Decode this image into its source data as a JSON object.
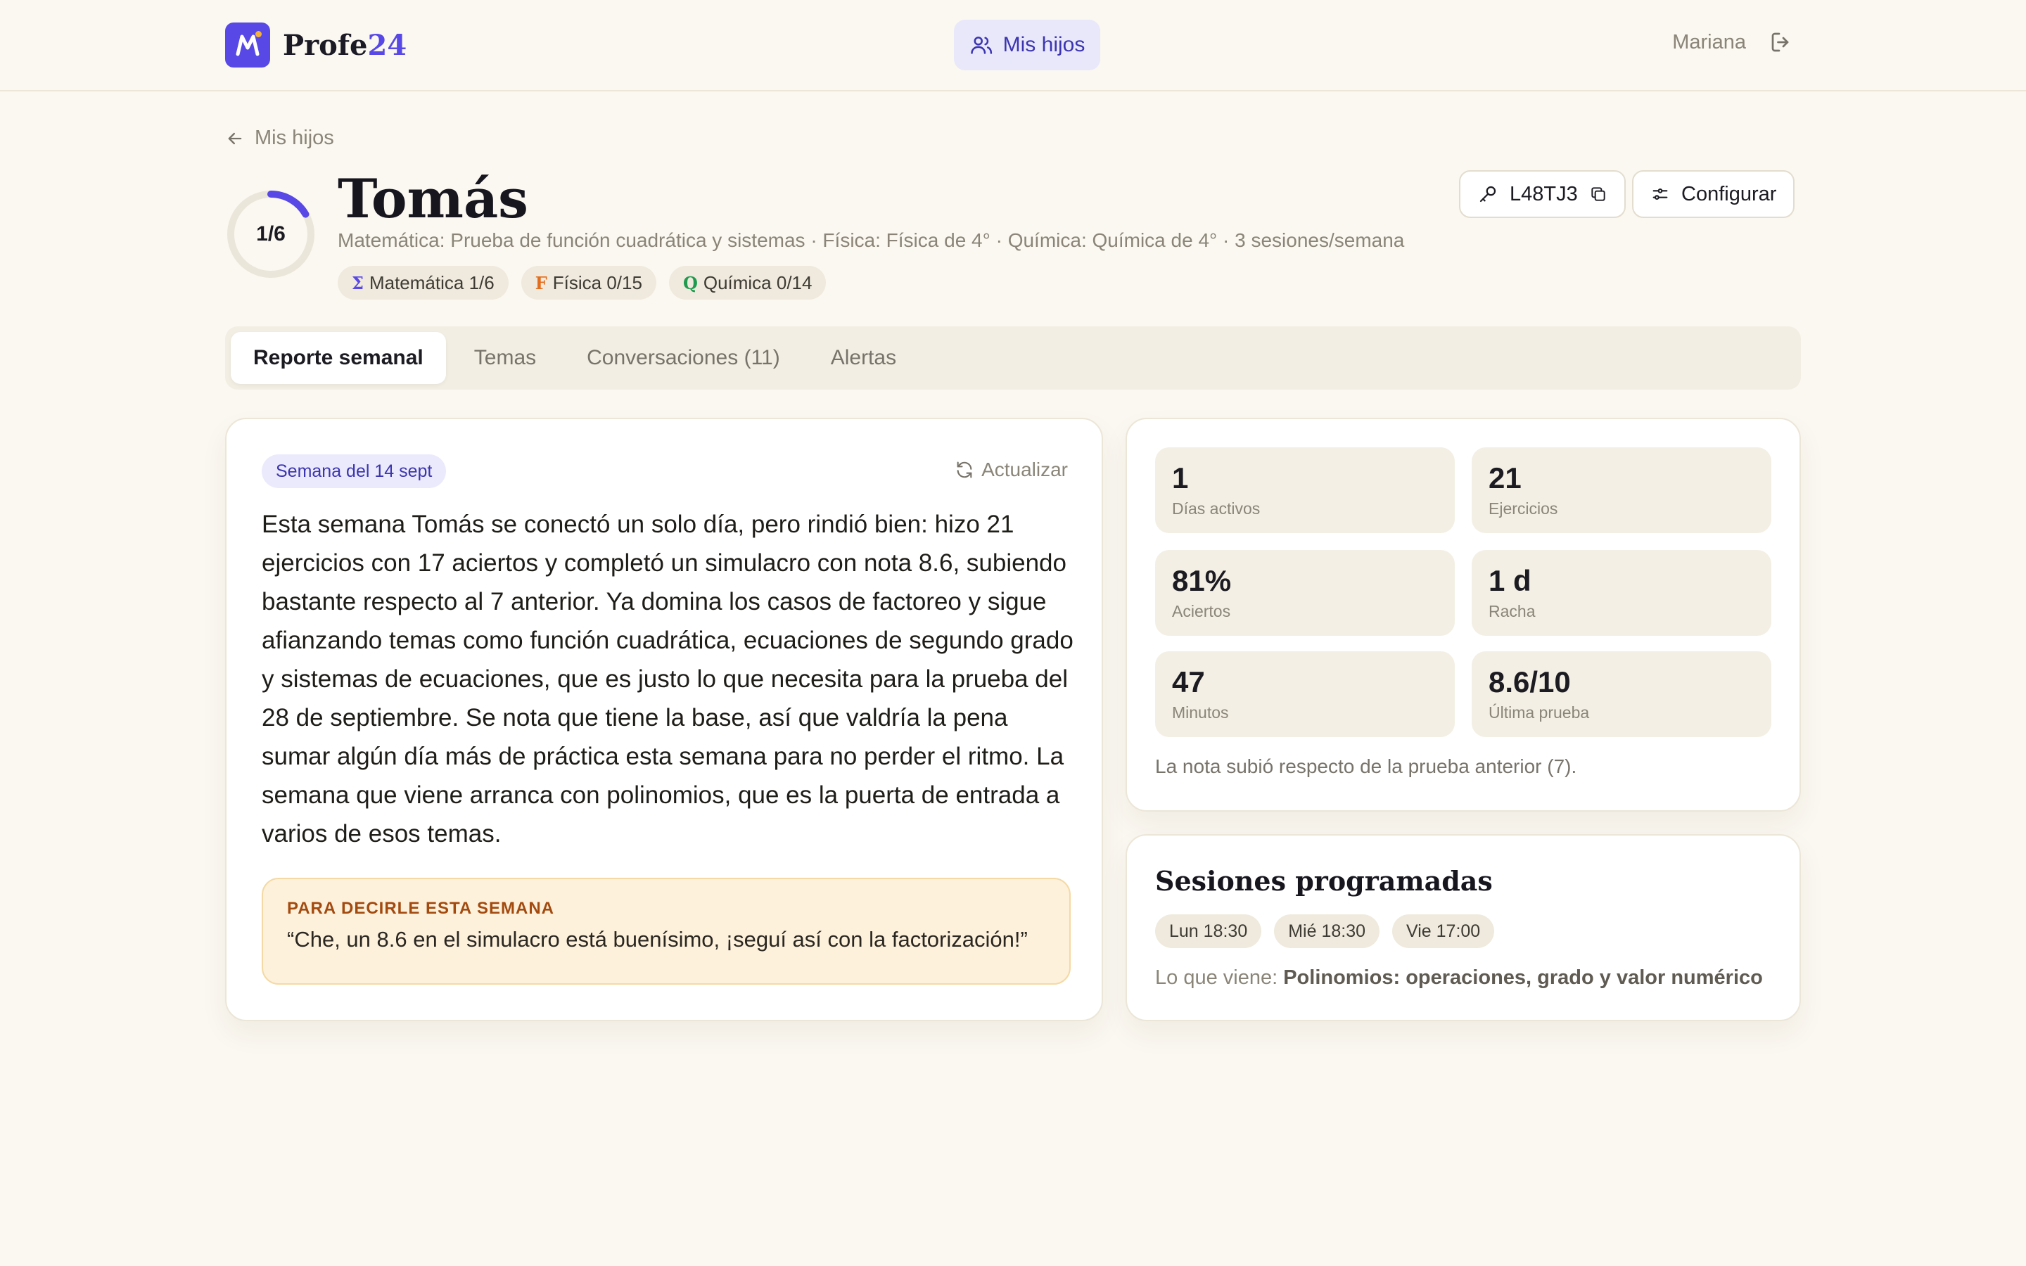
{
  "header": {
    "brand_prefix": "Profe",
    "brand_suffix": "24",
    "nav_label": "Mis hijos",
    "user_name": "Mariana"
  },
  "back_link": "Mis hijos",
  "profile": {
    "progress_label": "1/6",
    "progress_fraction": 0.1667,
    "name": "Tomás",
    "subtitle": "Matemática: Prueba de función cuadrática y sistemas · Física: Física de 4° · Química: Química de 4° · 3 sesiones/semana",
    "subjects": [
      {
        "symbol": "Σ",
        "label": "Matemática 1/6",
        "color": "#5848e6"
      },
      {
        "symbol": "F",
        "label": "Física 0/15",
        "color": "#e26d1c"
      },
      {
        "symbol": "Q",
        "label": "Química 0/14",
        "color": "#1f9a4e"
      }
    ],
    "code_label": "L48TJ3",
    "configure_label": "Configurar"
  },
  "tabs": [
    {
      "label": "Reporte semanal",
      "active": true
    },
    {
      "label": "Temas",
      "active": false
    },
    {
      "label": "Conversaciones (11)",
      "active": false
    },
    {
      "label": "Alertas",
      "active": false
    }
  ],
  "report": {
    "week_badge": "Semana del 14 sept",
    "refresh_label": "Actualizar",
    "body": "Esta semana Tomás se conectó un solo día, pero rindió bien: hizo 21 ejercicios con 17 aciertos y completó un simulacro con nota 8.6, subiendo bastante respecto al 7 anterior. Ya domina los casos de factoreo y sigue afianzando temas como función cuadrática, ecuaciones de segundo grado y sistemas de ecuaciones, que es justo lo que necesita para la prueba del 28 de septiembre. Se nota que tiene la base, así que valdría la pena sumar algún día más de práctica esta semana para no perder el ritmo. La semana que viene arranca con polinomios, que es la puerta de entrada a varios de esos temas.",
    "callout_title": "PARA DECIRLE ESTA SEMANA",
    "callout_text": "“Che, un 8.6 en el simulacro está buenísimo, ¡seguí así con la factorización!”"
  },
  "stats": {
    "items": [
      {
        "value": "1",
        "label": "Días activos"
      },
      {
        "value": "21",
        "label": "Ejercicios"
      },
      {
        "value": "81%",
        "label": "Aciertos"
      },
      {
        "value": "1 d",
        "label": "Racha"
      },
      {
        "value": "47",
        "label": "Minutos"
      },
      {
        "value": "8.6/10",
        "label": "Última prueba"
      }
    ],
    "note": "La nota subió respecto de la prueba anterior (7)."
  },
  "sessions": {
    "title": "Sesiones programadas",
    "slots": [
      "Lun 18:30",
      "Mié 18:30",
      "Vie 17:00"
    ],
    "next_prefix": "Lo que viene: ",
    "next_topic": "Polinomios: operaciones, grado y valor numérico"
  },
  "colors": {
    "accent": "#5848e6",
    "background": "#fbf8f1",
    "callout_bg": "#fdf1dc",
    "callout_title": "#a34a0f"
  }
}
